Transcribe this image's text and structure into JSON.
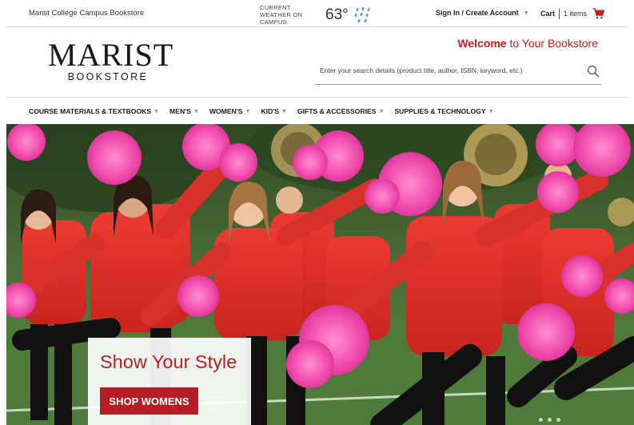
{
  "topbar": {
    "store_name": "Marist College Campus Bookstore",
    "weather_label": "CURRENT WEATHER ON CAMPUS",
    "weather_temp": "63°",
    "weather_icon": "rain-icon",
    "signin_label": "Sign In / Create Account",
    "cart_label": "Cart",
    "cart_count": "1 items",
    "cart_icon": "shopping-cart-icon"
  },
  "header": {
    "logo_main": "MARIST",
    "logo_sub": "BOOKSTORE",
    "welcome_bold": "Welcome",
    "welcome_rest": " to Your Bookstore",
    "search_placeholder": "Enter your search details (product title, author, ISBN, keyword, etc.)",
    "search_icon": "search-icon"
  },
  "nav": {
    "items": [
      {
        "label": "COURSE MATERIALS & TEXTBOOKS"
      },
      {
        "label": "MEN'S"
      },
      {
        "label": "WOMEN'S"
      },
      {
        "label": "KID'S"
      },
      {
        "label": "GIFTS & ACCESSORIES"
      },
      {
        "label": "SUPPLIES & TECHNOLOGY"
      }
    ]
  },
  "hero": {
    "promo_title": "Show Your Style",
    "promo_button": "SHOP WOMENS"
  },
  "colors": {
    "brand_red": "#c41e1e",
    "button_red": "#b51e24"
  }
}
